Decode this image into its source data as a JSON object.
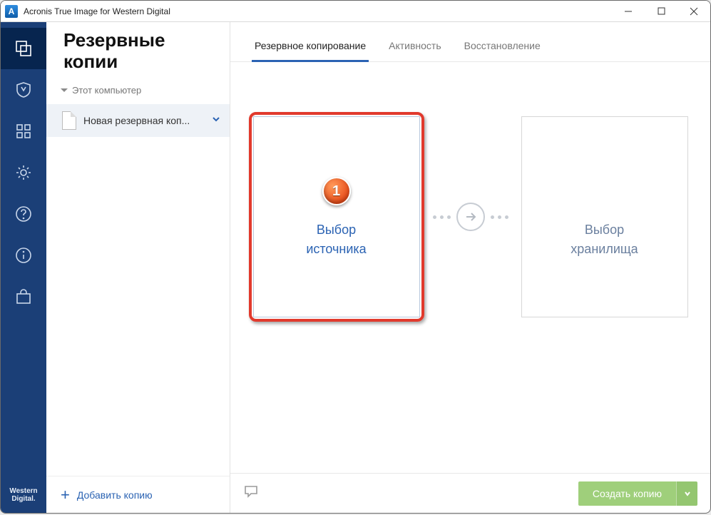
{
  "title": "Acronis True Image for Western Digital",
  "brand": {
    "line1": "Western",
    "line2": "Digital."
  },
  "sidebar": {
    "heading1": "Резервные",
    "heading2": "копии",
    "section": "Этот компьютер",
    "item": "Новая резервная коп...",
    "add": "Добавить копию"
  },
  "tabs": {
    "backup": "Резервное копирование",
    "activity": "Активность",
    "restore": "Восстановление"
  },
  "source": {
    "l1": "Выбор",
    "l2": "источника"
  },
  "dest": {
    "l1": "Выбор",
    "l2": "хранилища"
  },
  "callout": "1",
  "create": "Создать копию"
}
